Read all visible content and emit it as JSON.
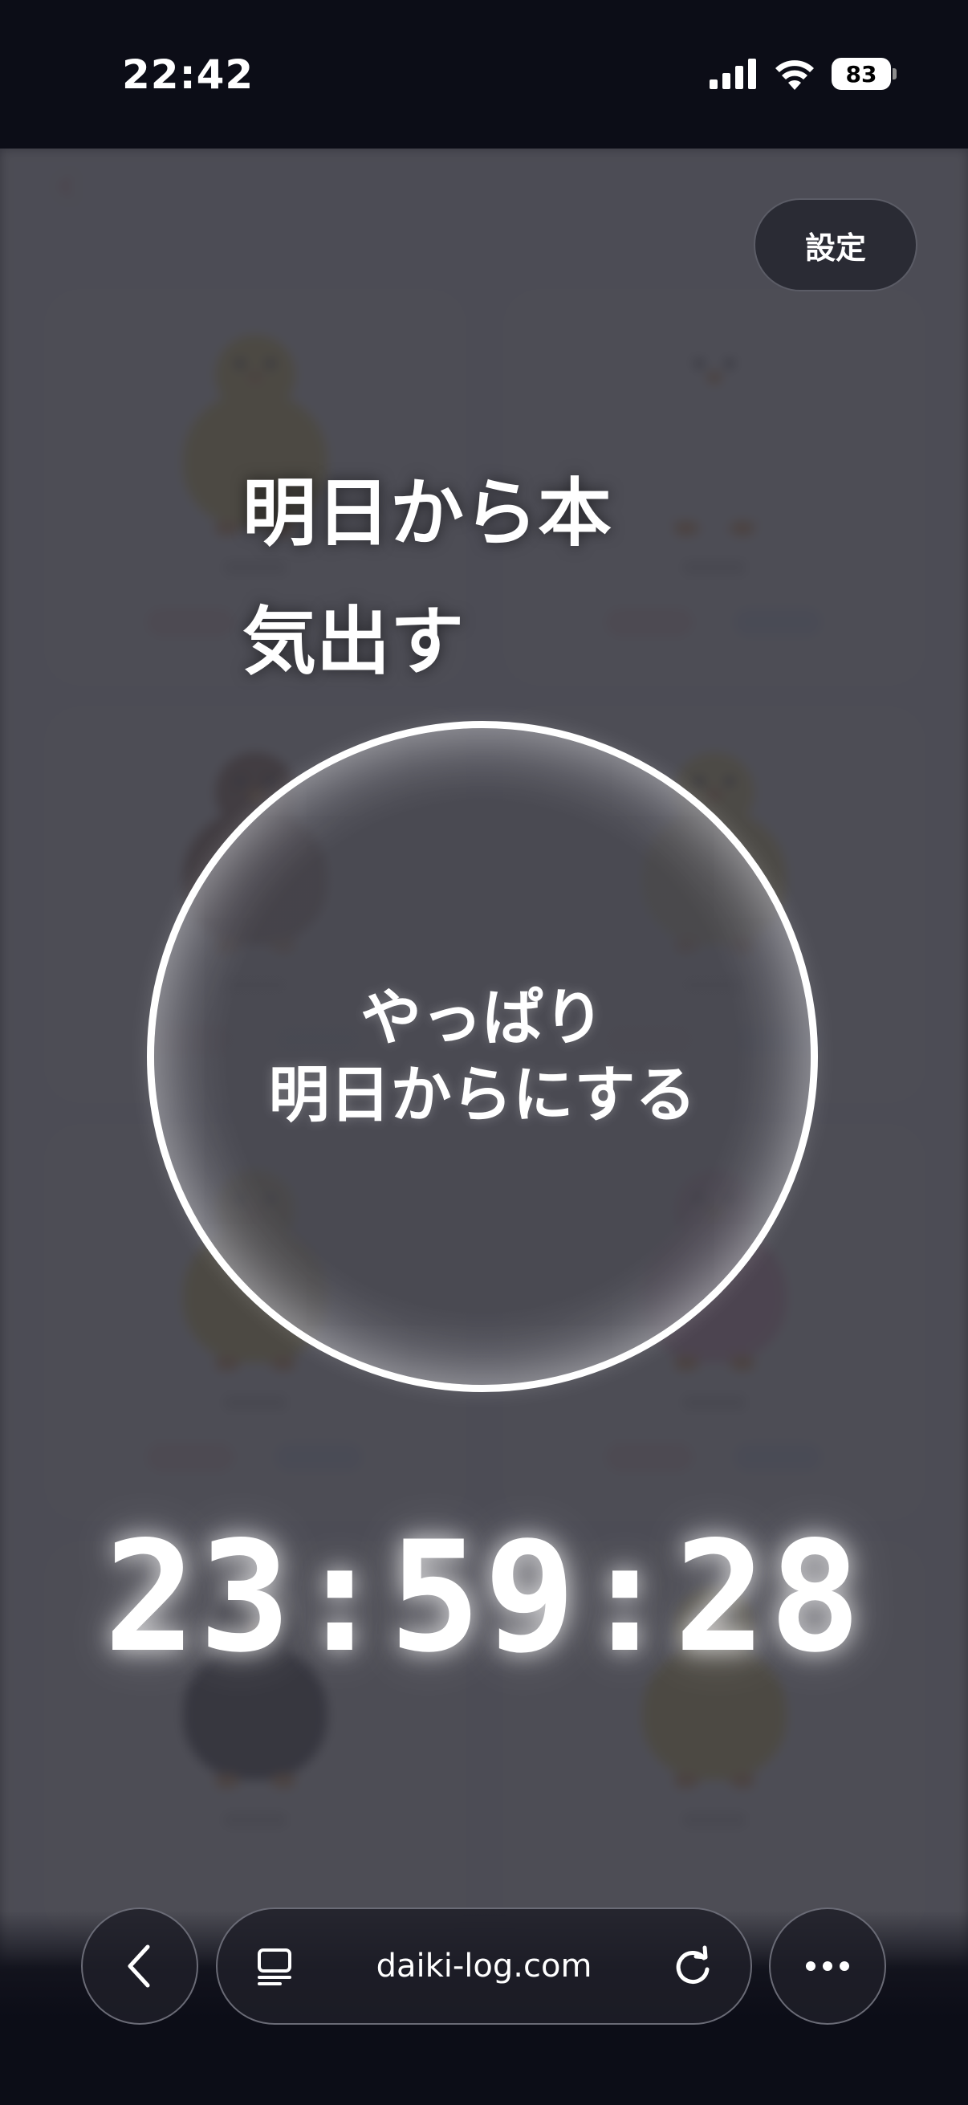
{
  "status_bar": {
    "time": "22:42",
    "battery": "83",
    "icons": [
      "signal-icon",
      "wifi-icon",
      "battery-icon"
    ]
  },
  "overlay": {
    "settings_label": "設定",
    "headline_line1": "明日から本",
    "headline_line2": "気出す",
    "tomorrow_button_line1": "やっぱり",
    "tomorrow_button_line2": "明日からにする",
    "countdown": "23:59:28"
  },
  "browser": {
    "url": "daiki-log.com",
    "icons": [
      "back-icon",
      "reader-icon",
      "reload-icon",
      "more-icon"
    ]
  },
  "colors": {
    "background": "#0c0d17",
    "overlay_dim": "#3a3a42",
    "text": "#ffffff",
    "button_bg": "#2a2b34"
  }
}
